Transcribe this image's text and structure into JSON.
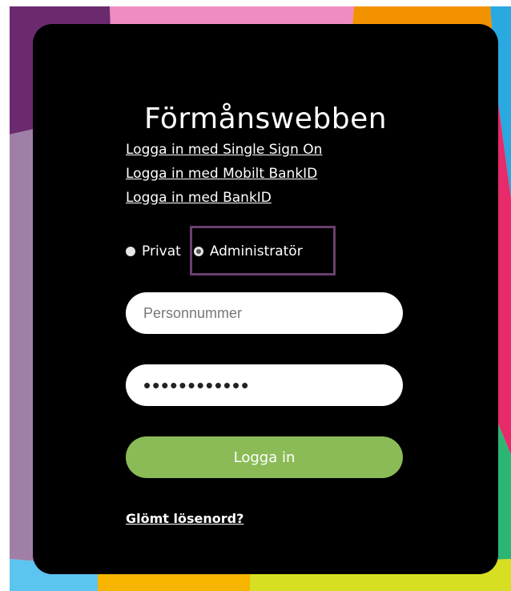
{
  "title": "Förmånswebben",
  "login_links": [
    {
      "label": "Logga in med Single Sign On"
    },
    {
      "label": "Logga in med Mobilt BankID"
    },
    {
      "label": "Logga in med BankID"
    }
  ],
  "user_type": {
    "options": [
      {
        "label": "Privat",
        "checked": false
      },
      {
        "label": "Administratör",
        "checked": true
      }
    ],
    "selected": "Administratör"
  },
  "fields": {
    "personnummer_placeholder": "Personnummer",
    "password_value": "••••••••••••"
  },
  "login_button_label": "Logga in",
  "forgot_password_label": "Glömt lösenord?",
  "colors": {
    "card": "#000000",
    "button": "#8bbb56",
    "highlight_border": "#6b3f6f"
  }
}
